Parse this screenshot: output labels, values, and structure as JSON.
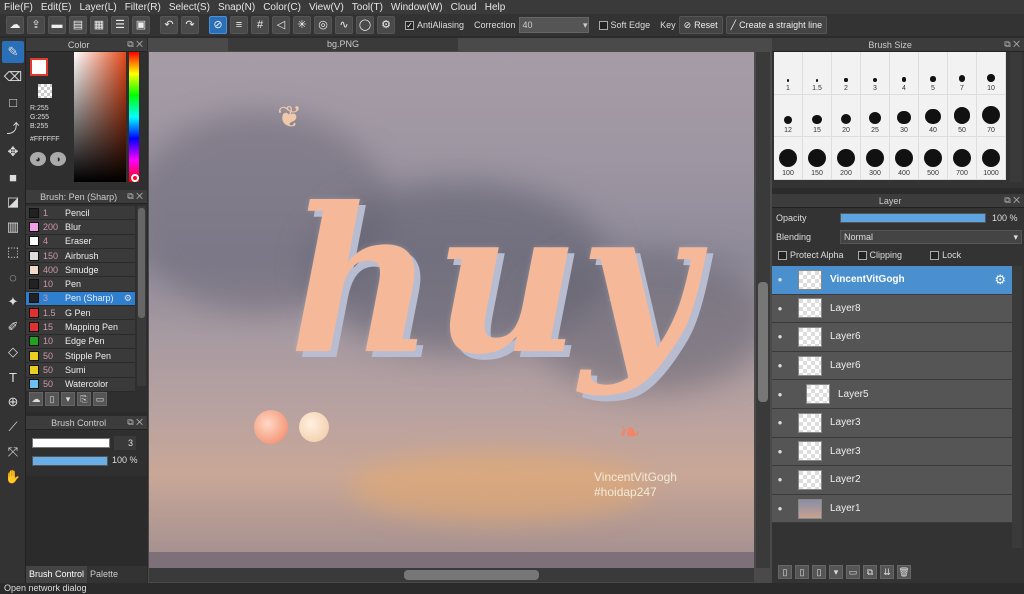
{
  "menu": [
    "File(F)",
    "Edit(E)",
    "Layer(L)",
    "Filter(R)",
    "Select(S)",
    "Snap(N)",
    "Color(C)",
    "View(V)",
    "Tool(T)",
    "Window(W)",
    "Cloud",
    "Help"
  ],
  "toolbar": {
    "antialiasing": "AntiAliasing",
    "correction_label": "Correction",
    "correction_value": "40",
    "soft_edge": "Soft Edge",
    "key": "Key",
    "reset": "Reset",
    "straight_line": "Create a straight line"
  },
  "color_panel": {
    "title": "Color",
    "r": "R:255",
    "g": "G:255",
    "b": "B:255",
    "hex": "#FFFFFF",
    "primary_color": "#ffffff",
    "accent": "#e23a2a"
  },
  "brush_panel": {
    "title": "Brush: Pen (Sharp)",
    "items": [
      {
        "size": "1",
        "name": "Pencil",
        "color": "#222222"
      },
      {
        "size": "200",
        "name": "Blur",
        "color": "#f2a0e6"
      },
      {
        "size": "4",
        "name": "Eraser",
        "color": "#ffffff"
      },
      {
        "size": "150",
        "name": "Airbrush",
        "color": "#dddddd"
      },
      {
        "size": "400",
        "name": "Smudge",
        "color": "#f3d9c9"
      },
      {
        "size": "10",
        "name": "Pen",
        "color": "#222222"
      },
      {
        "size": "3",
        "name": "Pen (Sharp)",
        "color": "#222222"
      },
      {
        "size": "1.5",
        "name": "G Pen",
        "color": "#e03030"
      },
      {
        "size": "15",
        "name": "Mapping Pen",
        "color": "#e03030"
      },
      {
        "size": "10",
        "name": "Edge Pen",
        "color": "#22a022"
      },
      {
        "size": "50",
        "name": "Stipple Pen",
        "color": "#e8d020"
      },
      {
        "size": "50",
        "name": "Sumi",
        "color": "#e8d020"
      },
      {
        "size": "50",
        "name": "Watercolor",
        "color": "#6bc0ee"
      }
    ]
  },
  "brush_control": {
    "title": "Brush Control",
    "size": "3",
    "opacity": "100 %",
    "opacity_value": 1.0
  },
  "bottom_tabs": [
    "Brush Control",
    "Palette"
  ],
  "document": {
    "tab": "bg.PNG",
    "artwork_text": "huy",
    "watermark1": "VincentVitGogh",
    "watermark2": "#hoidap247"
  },
  "brush_size": {
    "title": "Brush Size",
    "sizes": [
      "1",
      "1.5",
      "2",
      "3",
      "4",
      "5",
      "7",
      "10",
      "12",
      "15",
      "20",
      "25",
      "30",
      "40",
      "50",
      "70",
      "100",
      "150",
      "200",
      "300",
      "400",
      "500",
      "700",
      "1000"
    ]
  },
  "layer_panel": {
    "title": "Layer",
    "opacity_label": "Opacity",
    "opacity_value": "100 %",
    "opacity_fraction": 1.0,
    "blending_label": "Blending",
    "blending_value": "Normal",
    "protect_alpha": "Protect Alpha",
    "clipping": "Clipping",
    "lock": "Lock",
    "layers": [
      "VincentVitGogh",
      "Layer8",
      "Layer6",
      "Layer6",
      "Layer5",
      "Layer3",
      "Layer3",
      "Layer2",
      "Layer1"
    ]
  },
  "status": "Open network dialog"
}
